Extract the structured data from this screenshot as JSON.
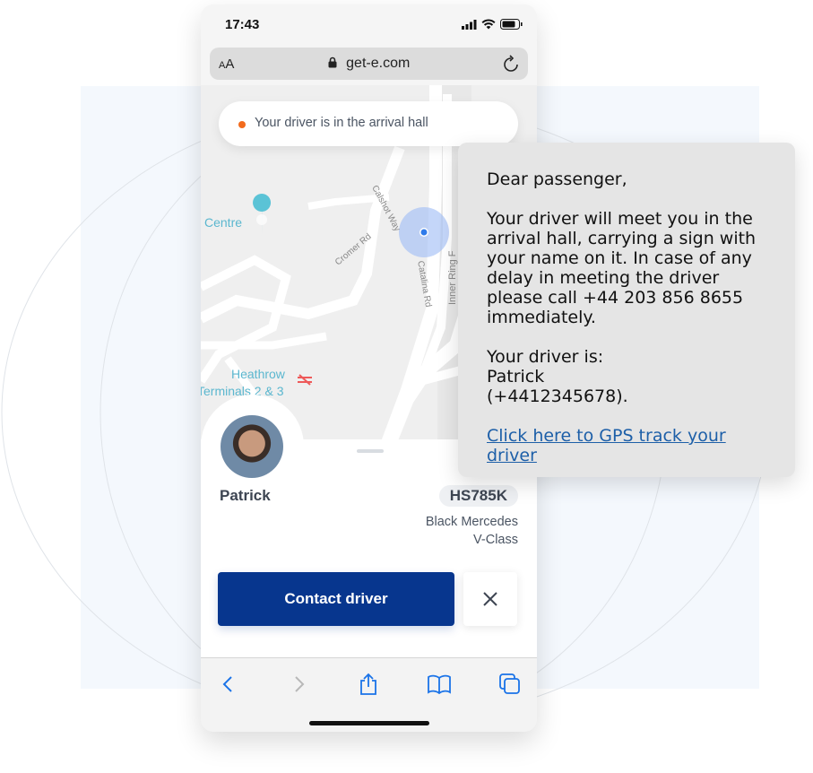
{
  "status_bar": {
    "time": "17:43",
    "icons": [
      "cellular-signal-icon",
      "wifi-icon",
      "battery-icon"
    ]
  },
  "browser": {
    "text_size_label_small": "A",
    "text_size_label_large": "A",
    "url": "get-e.com",
    "lock_icon": "lock-icon",
    "reload_icon": "reload-icon"
  },
  "map": {
    "labels": {
      "centre": "Centre",
      "calshot_way": "Calshot Way",
      "cromer_rd": "Cromer Rd",
      "catalina_rd": "Catalina Rd",
      "inner_ring": "Inner Ring F",
      "heathrow_line1": "Heathrow",
      "heathrow_line2": "Terminals 2 & 3"
    },
    "location_marker_color": "#2f7bea",
    "poi_color": "#5bc3d6",
    "rail_color": "#ee5a5a"
  },
  "notice": {
    "text": "Your driver is in the arrival hall",
    "dot_color": "#f26b1d"
  },
  "driver": {
    "name": "Patrick",
    "plate": "HS785K",
    "car_line1": "Black Mercedes",
    "car_line2": "V-Class"
  },
  "actions": {
    "contact_label": "Contact driver",
    "close_icon": "close-icon",
    "primary_color": "#07368e"
  },
  "toolbar": {
    "items": [
      "back-icon",
      "forward-icon",
      "share-icon",
      "bookmarks-icon",
      "tabs-icon"
    ]
  },
  "sms": {
    "greeting": "Dear passenger,",
    "body": "Your driver will meet you in the arrival hall, carrying a sign with your name on it. In case of any delay in meeting the driver please call +44 203 856 8655 immediately.",
    "driver_intro": "Your driver is:",
    "driver_name": "Patrick",
    "driver_phone": "(+4412345678).",
    "link_text": "Click here to GPS track your driver"
  }
}
